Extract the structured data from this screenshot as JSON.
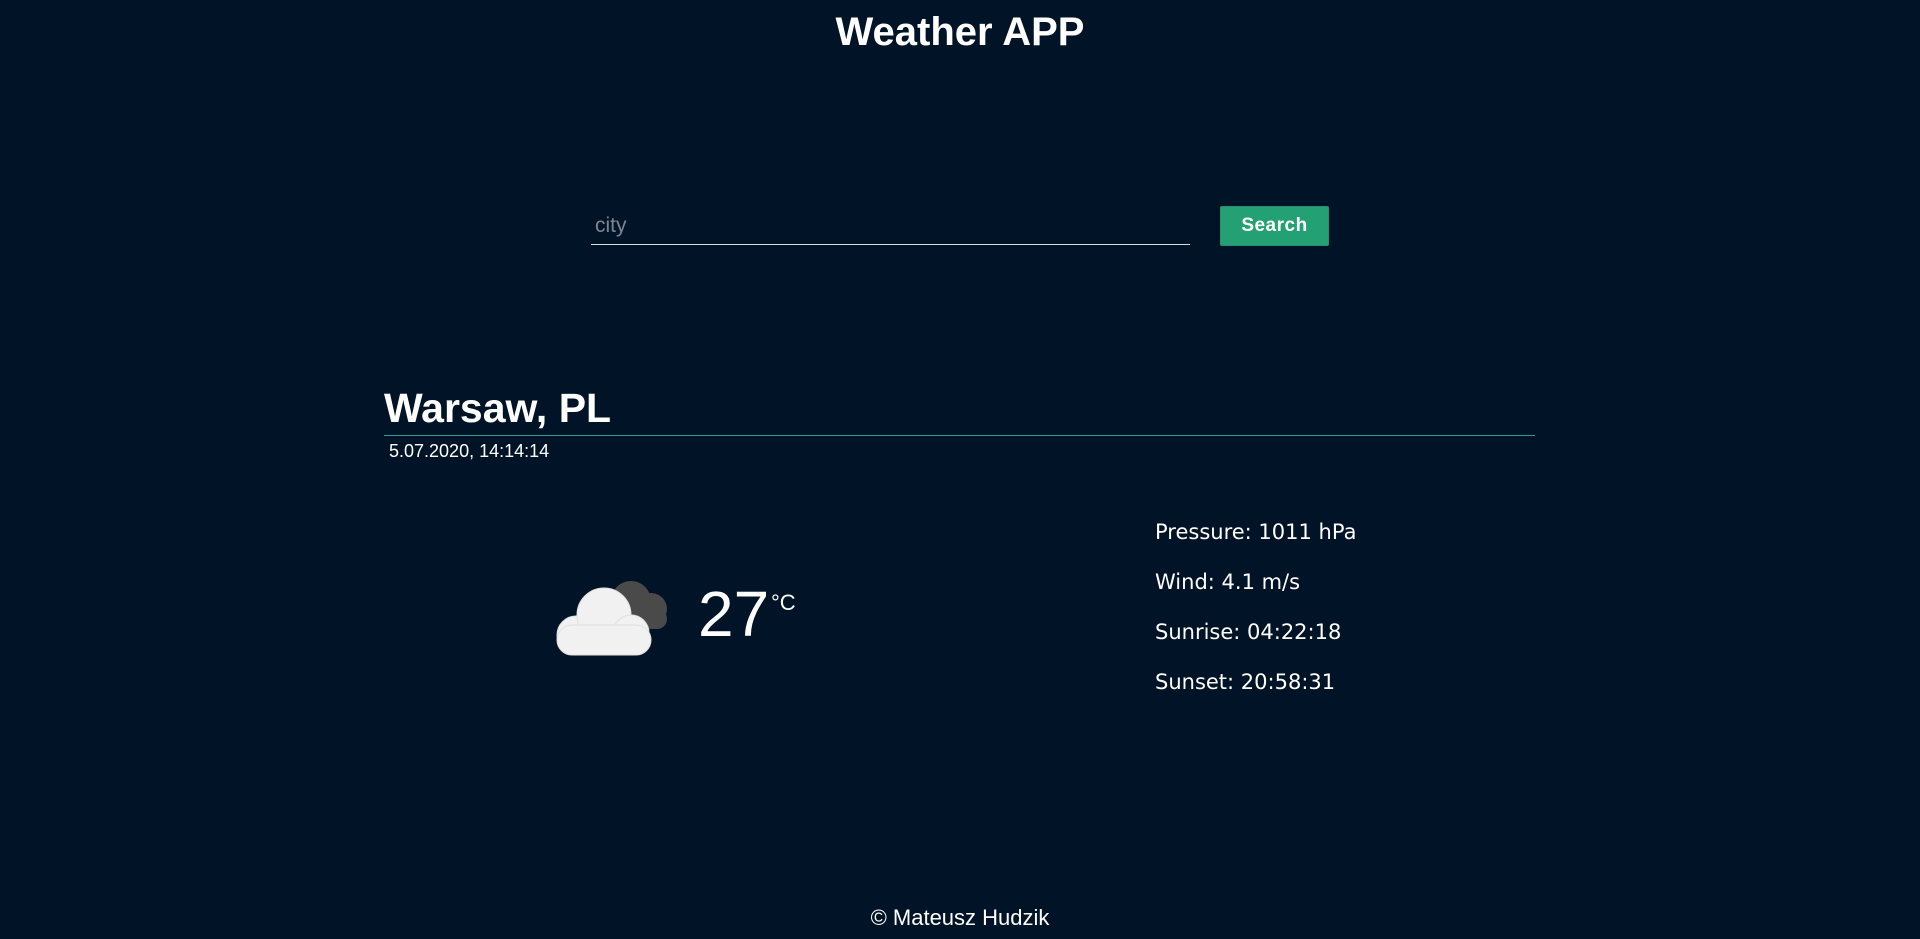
{
  "app": {
    "title": "Weather APP"
  },
  "search": {
    "placeholder": "city",
    "value": "",
    "button_label": "Search"
  },
  "weather": {
    "location": "Warsaw, PL",
    "datetime": "5.07.2020, 14:14:14",
    "icon": "cloud-icon",
    "temperature": "27",
    "unit": "°C",
    "details": [
      "Pressure: 1011 hPa",
      "Wind: 4.1 m/s",
      "Sunrise: 04:22:18",
      "Sunset: 20:58:31"
    ]
  },
  "footer": {
    "text": "© Mateusz Hudzik"
  },
  "colors": {
    "background": "#011427",
    "accent": "#24a075",
    "divider": "#2d9c8b"
  }
}
